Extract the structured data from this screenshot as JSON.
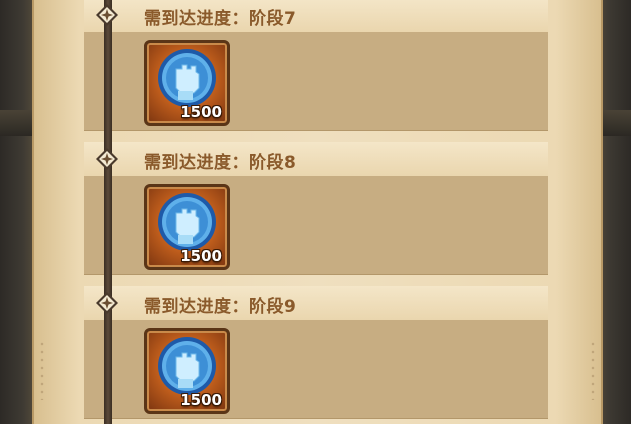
{
  "stages": [
    {
      "title": "需到达进度：阶段7",
      "reward": {
        "icon": "fist-coin-icon",
        "amount": "1500"
      }
    },
    {
      "title": "需到达进度：阶段8",
      "reward": {
        "icon": "fist-coin-icon",
        "amount": "1500"
      }
    },
    {
      "title": "需到达进度：阶段9",
      "reward": {
        "icon": "fist-coin-icon",
        "amount": "1500"
      }
    }
  ],
  "colors": {
    "title_text": "#8a5a2b",
    "timeline": "#3a2d22",
    "card_body": "#c7ad82",
    "card_header": "#f4e6c8"
  }
}
